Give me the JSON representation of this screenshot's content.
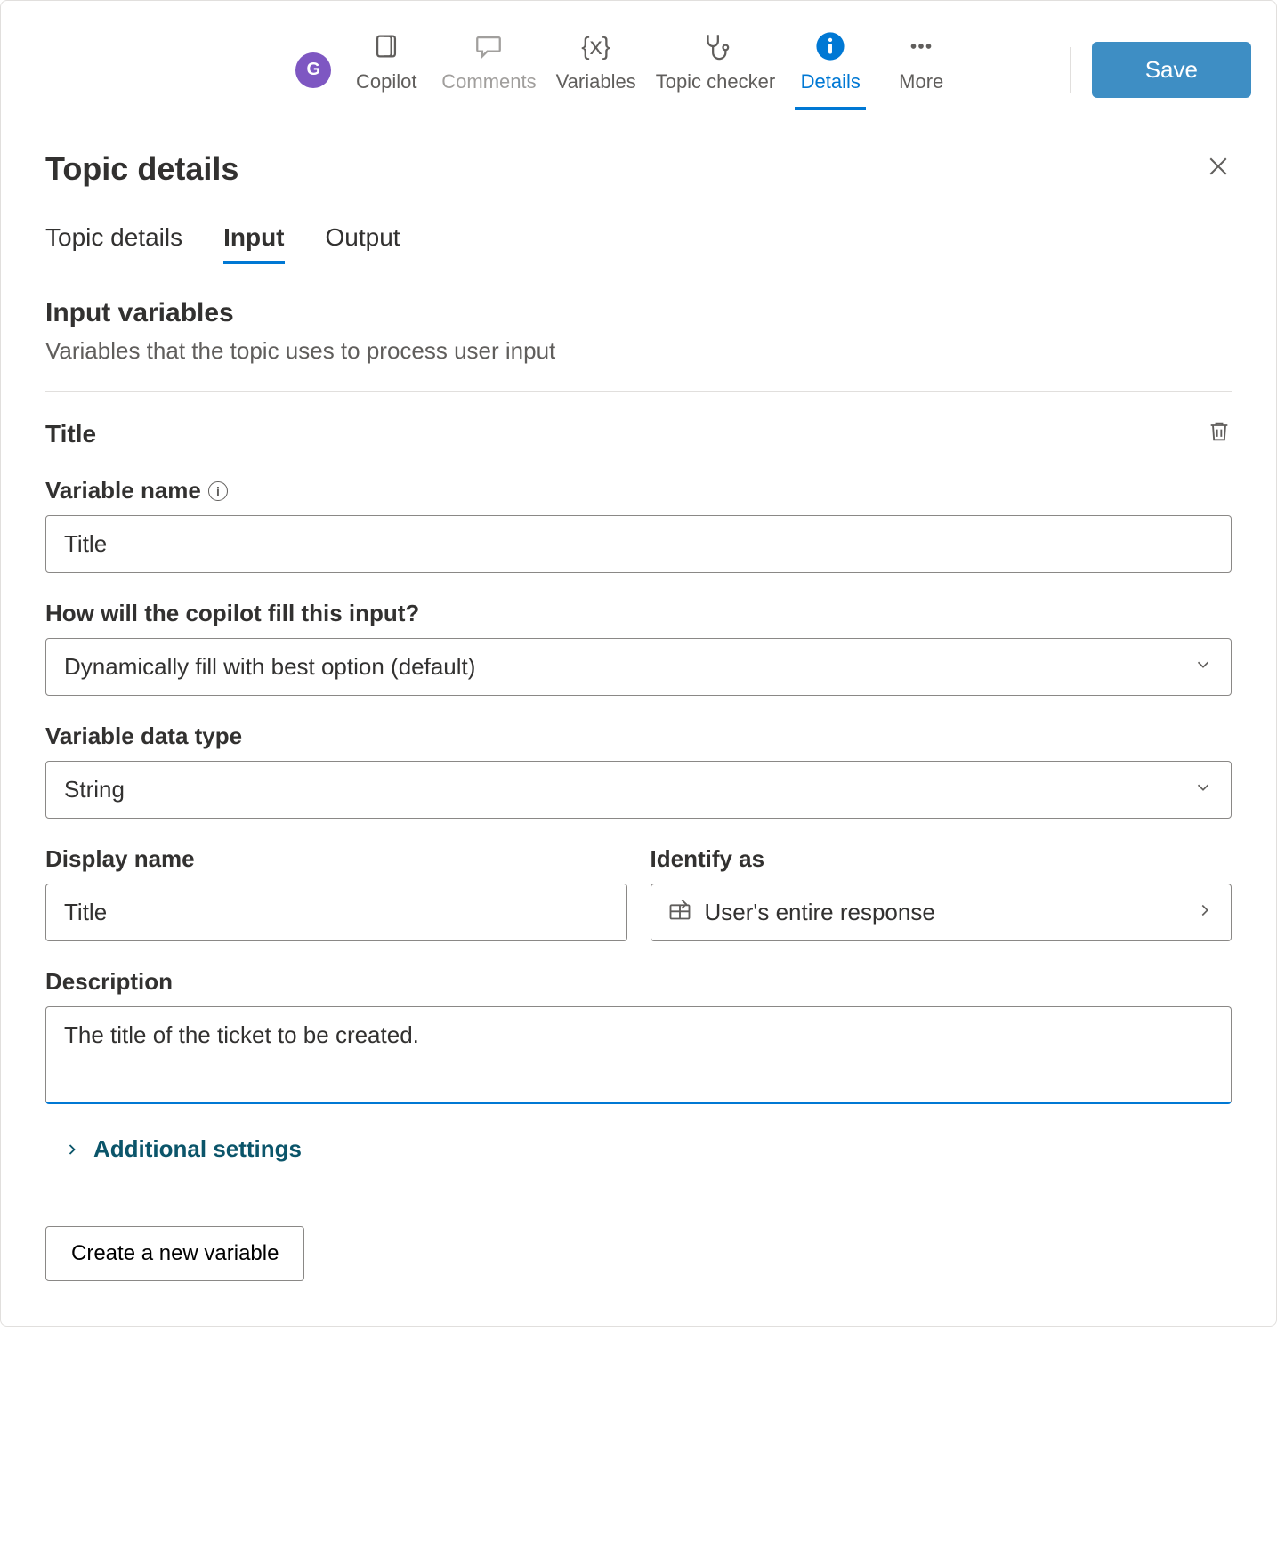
{
  "toolbar": {
    "avatar_initial": "G",
    "items": [
      {
        "label": "Copilot",
        "active": false,
        "disabled": false
      },
      {
        "label": "Comments",
        "active": false,
        "disabled": true
      },
      {
        "label": "Variables",
        "active": false,
        "disabled": false
      },
      {
        "label": "Topic checker",
        "active": false,
        "disabled": false
      },
      {
        "label": "Details",
        "active": true,
        "disabled": false
      },
      {
        "label": "More",
        "active": false,
        "disabled": false
      }
    ],
    "save_label": "Save"
  },
  "panel": {
    "title": "Topic details",
    "tabs": [
      {
        "label": "Topic details",
        "active": false
      },
      {
        "label": "Input",
        "active": true
      },
      {
        "label": "Output",
        "active": false
      }
    ],
    "section_title": "Input variables",
    "section_sub": "Variables that the topic uses to process user input",
    "variable": {
      "title": "Title",
      "variable_name_label": "Variable name",
      "variable_name_value": "Title",
      "fill_label": "How will the copilot fill this input?",
      "fill_value": "Dynamically fill with best option (default)",
      "datatype_label": "Variable data type",
      "datatype_value": "String",
      "display_name_label": "Display name",
      "display_name_value": "Title",
      "identify_label": "Identify as",
      "identify_value": "User's entire response",
      "description_label": "Description",
      "description_value": "The title of the ticket to be created.",
      "additional_settings": "Additional settings"
    },
    "create_label": "Create a new variable"
  }
}
